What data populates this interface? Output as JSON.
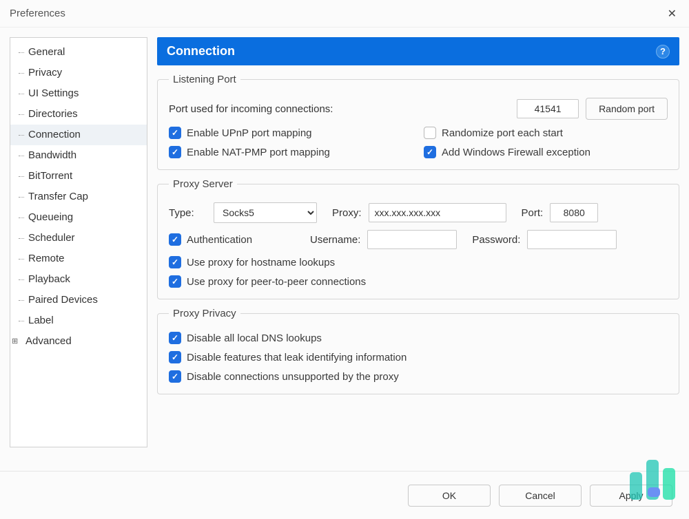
{
  "window": {
    "title": "Preferences"
  },
  "sidebar": {
    "items": [
      {
        "label": "General"
      },
      {
        "label": "Privacy"
      },
      {
        "label": "UI Settings"
      },
      {
        "label": "Directories"
      },
      {
        "label": "Connection",
        "selected": true
      },
      {
        "label": "Bandwidth"
      },
      {
        "label": "BitTorrent"
      },
      {
        "label": "Transfer Cap"
      },
      {
        "label": "Queueing"
      },
      {
        "label": "Scheduler"
      },
      {
        "label": "Remote"
      },
      {
        "label": "Playback"
      },
      {
        "label": "Paired Devices"
      },
      {
        "label": "Label"
      },
      {
        "label": "Advanced",
        "expandable": true
      }
    ]
  },
  "header": {
    "title": "Connection",
    "help": "?"
  },
  "listening": {
    "legend": "Listening Port",
    "port_label": "Port used for incoming connections:",
    "port_value": "41541",
    "random_button": "Random port",
    "enable_upnp": "Enable UPnP port mapping",
    "enable_natpmp": "Enable NAT-PMP port mapping",
    "randomize": "Randomize port each start",
    "firewall": "Add Windows Firewall exception"
  },
  "proxy": {
    "legend": "Proxy Server",
    "type_label": "Type:",
    "type_value": "Socks5",
    "proxy_label": "Proxy:",
    "proxy_value": "xxx.xxx.xxx.xxx",
    "port_label": "Port:",
    "port_value": "8080",
    "auth": "Authentication",
    "username_label": "Username:",
    "username_value": "",
    "password_label": "Password:",
    "password_value": "",
    "hostname_lookups": "Use proxy for hostname lookups",
    "p2p": "Use proxy for peer-to-peer connections"
  },
  "privacy": {
    "legend": "Proxy Privacy",
    "dns": "Disable all local DNS lookups",
    "leak": "Disable features that leak identifying information",
    "unsupported": "Disable connections unsupported by the proxy"
  },
  "footer": {
    "ok": "OK",
    "cancel": "Cancel",
    "apply": "Apply"
  }
}
